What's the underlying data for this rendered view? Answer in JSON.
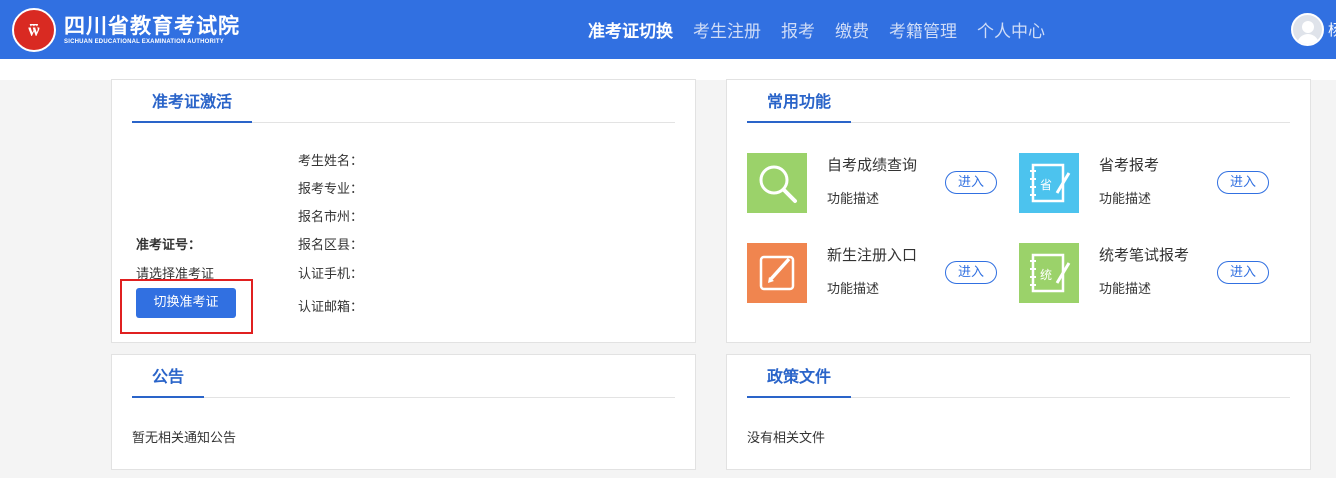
{
  "header": {
    "logo_mark": "ѿ",
    "logo_cn": "四川省教育考试院",
    "logo_en": "SICHUAN EDUCATIONAL EXAMINATION AUTHORITY",
    "nav": [
      "准考证切换",
      "考生注册",
      "报考",
      "缴费",
      "考籍管理",
      "个人中心"
    ],
    "active_nav": "准考证切换",
    "user_name": "杨",
    "bg_color": "#3170e1"
  },
  "activation": {
    "title": "准考证激活",
    "ticket_label": "准考证号：",
    "ticket_value": "请选择准考证",
    "switch_button": "切换准考证",
    "fields": [
      "考生姓名：",
      "报考专业：",
      "报名市州：",
      "报名区县：",
      "认证手机：",
      "认证邮箱："
    ]
  },
  "functions": {
    "title": "常用功能",
    "items": [
      {
        "title": "自考成绩查询",
        "desc": "功能描述",
        "button": "进入",
        "icon": "search-icon",
        "color": "#9bd26a"
      },
      {
        "title": "省考报考",
        "desc": "功能描述",
        "button": "进入",
        "icon": "notebook-sheng-icon",
        "color": "#4cc3ee"
      },
      {
        "title": "新生注册入口",
        "desc": "功能描述",
        "button": "进入",
        "icon": "edit-icon",
        "color": "#f0854f"
      },
      {
        "title": "统考笔试报考",
        "desc": "功能描述",
        "button": "进入",
        "icon": "notebook-tong-icon",
        "color": "#9bd26a"
      }
    ]
  },
  "announcements": {
    "title": "公告",
    "empty_text": "暂无相关通知公告"
  },
  "policies": {
    "title": "政策文件",
    "empty_text": "没有相关文件"
  }
}
